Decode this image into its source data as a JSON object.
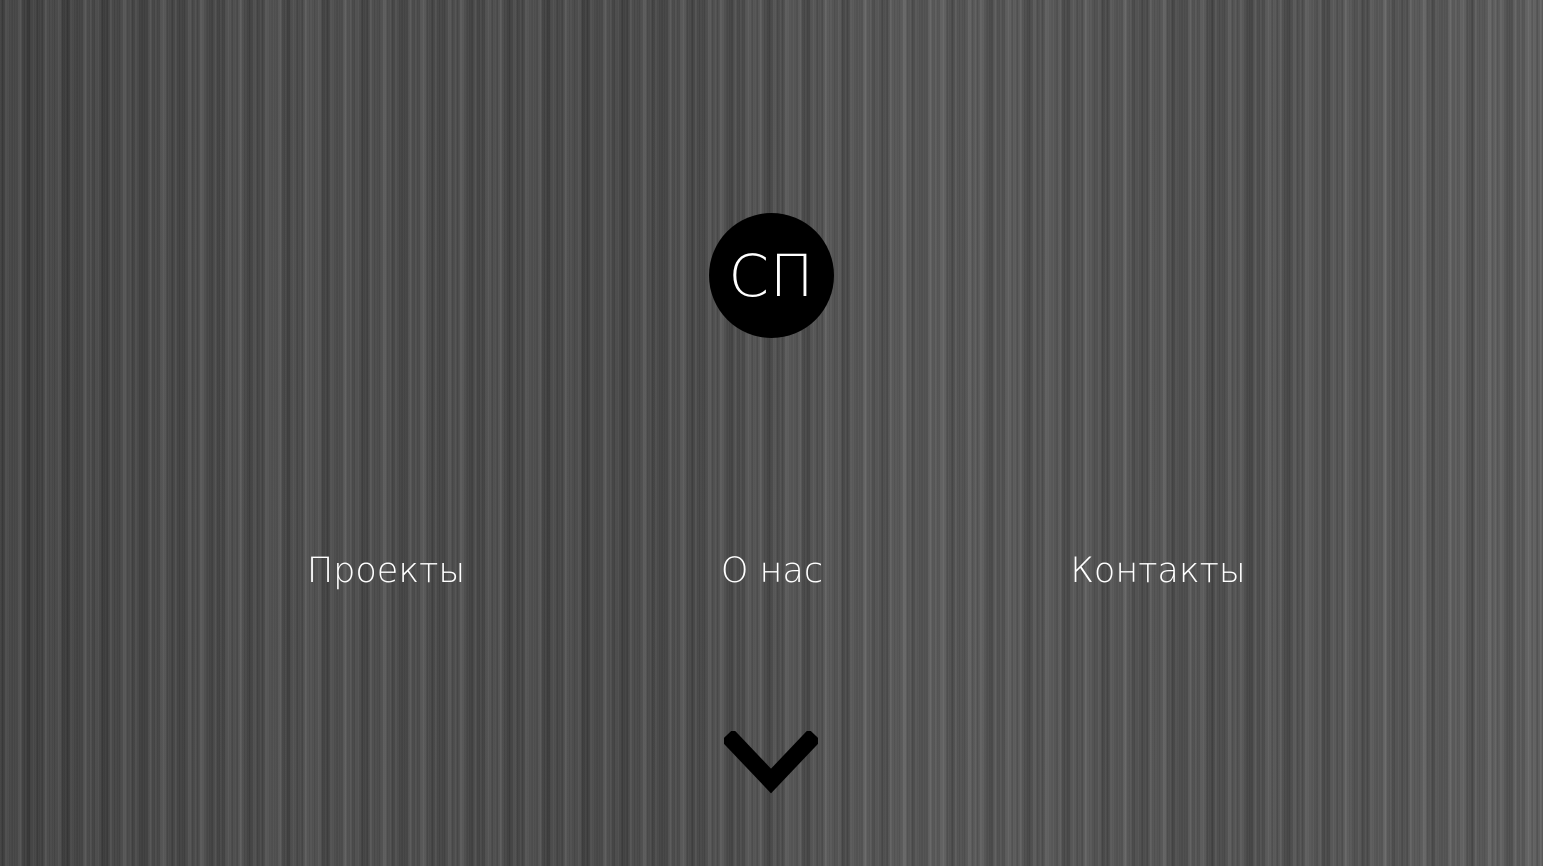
{
  "logo": {
    "text": "СП"
  },
  "nav": {
    "items": [
      {
        "label": "Проекты"
      },
      {
        "label": "О нас"
      },
      {
        "label": "Контакты"
      }
    ]
  },
  "scroll_indicator": {
    "icon": "chevron-down-icon"
  },
  "colors": {
    "text": "#ffffff",
    "logo_background": "#000000",
    "chevron": "#000000",
    "background": "#4a4a4a"
  }
}
